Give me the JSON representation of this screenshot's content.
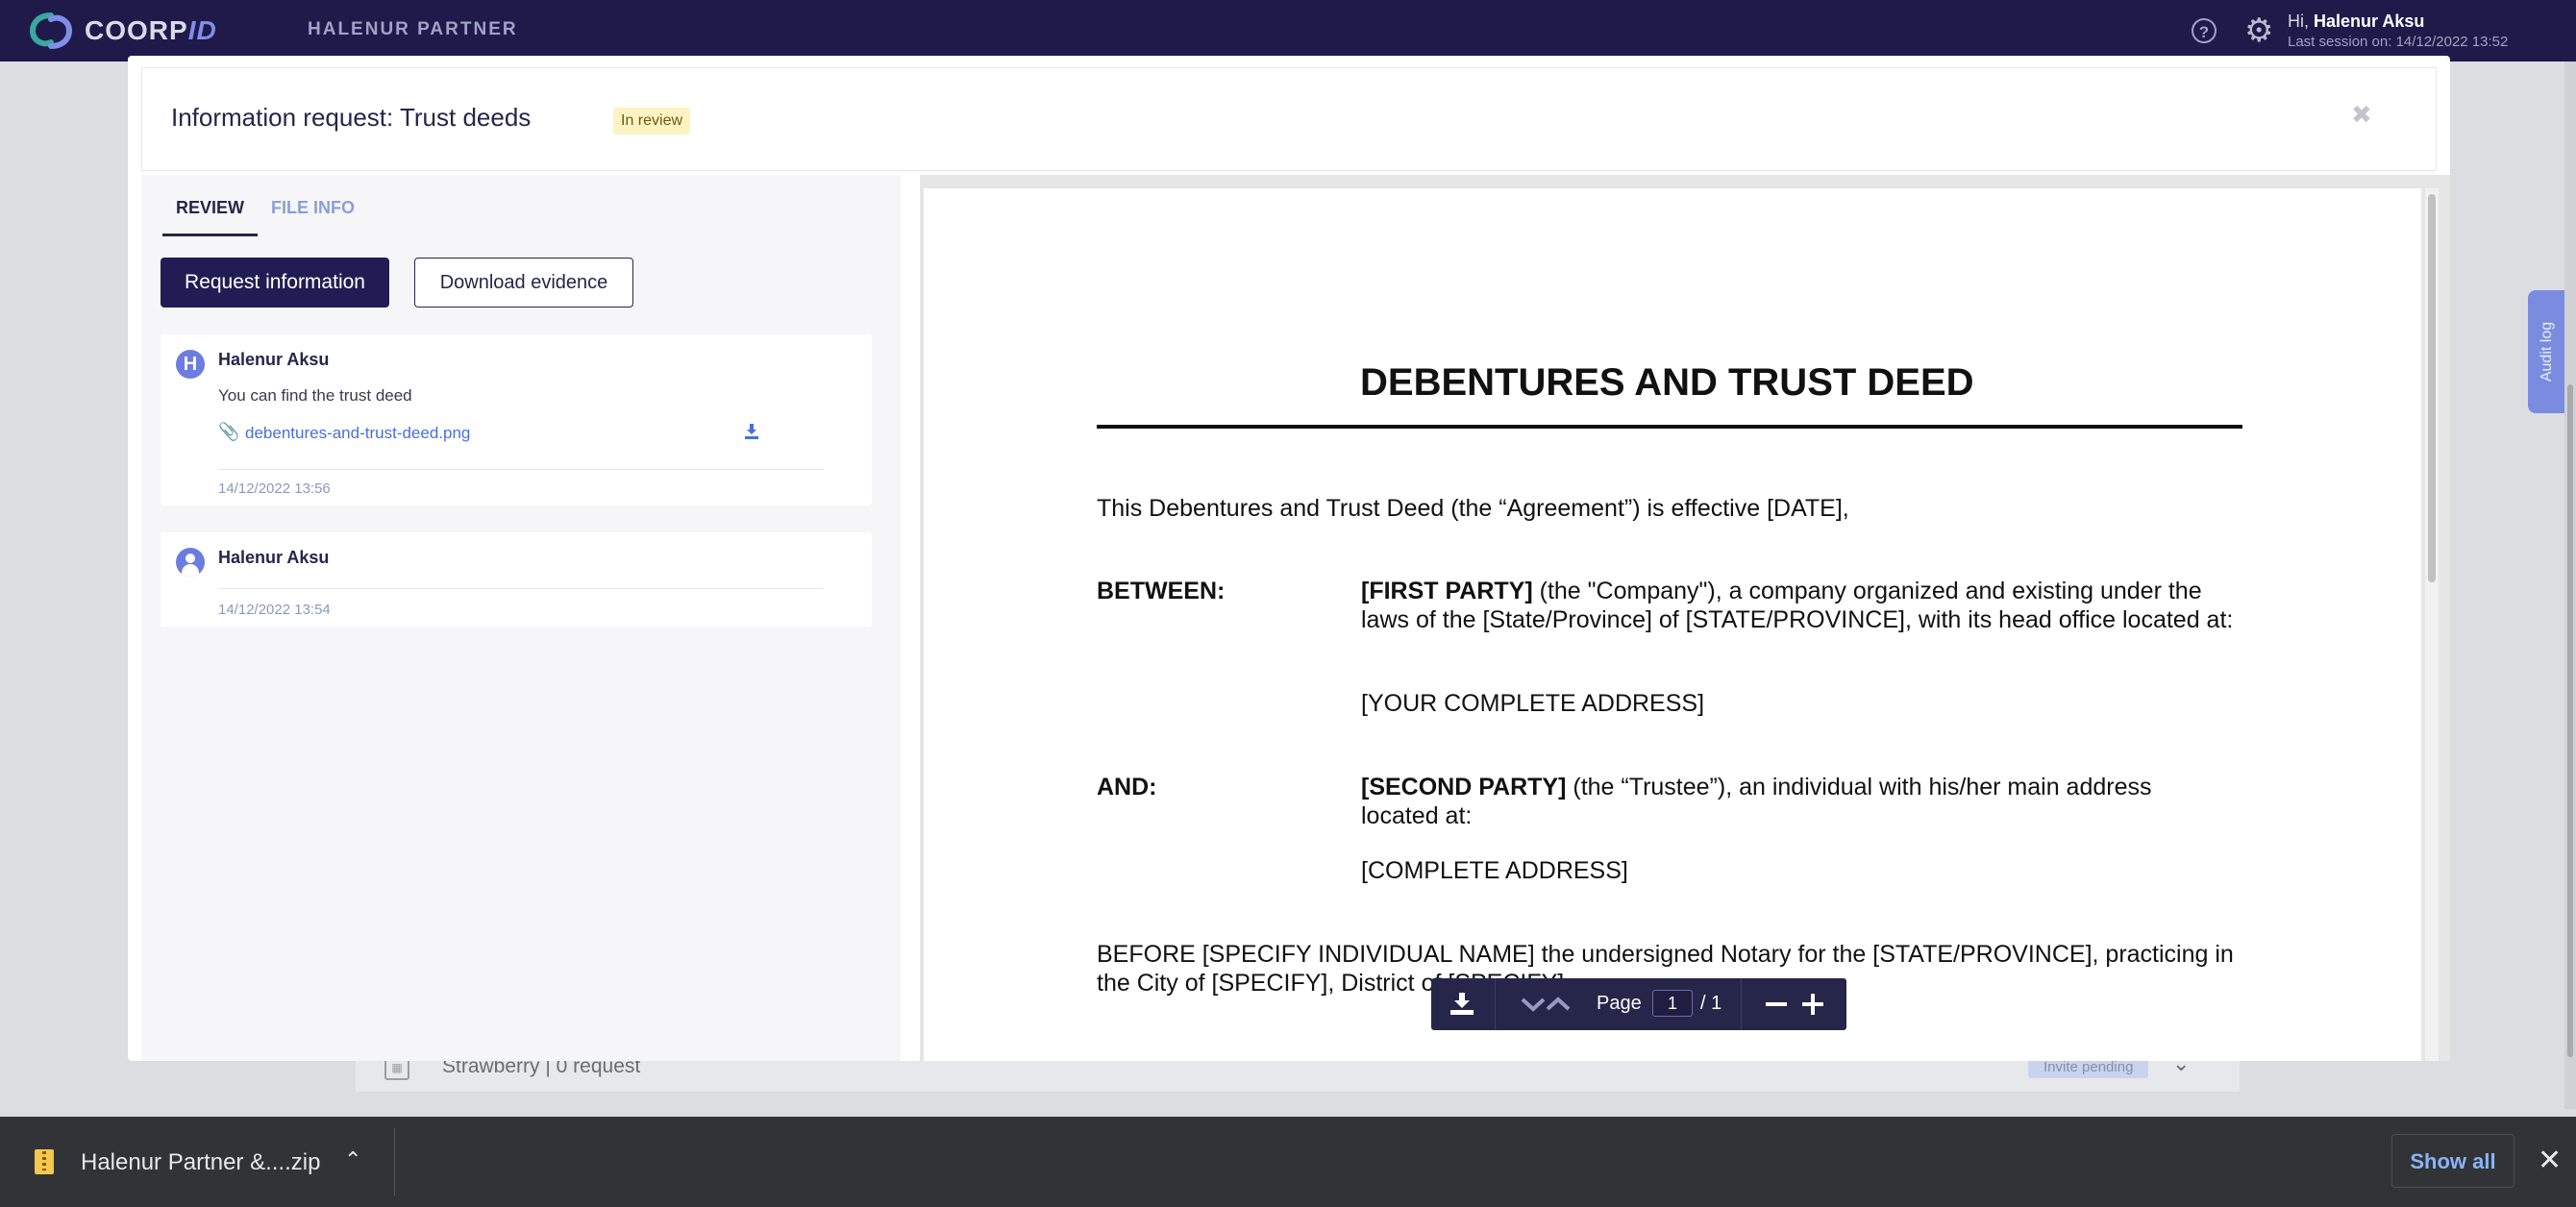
{
  "topbar": {
    "brand_main": "COORP",
    "brand_accent": "ID",
    "company": "HALENUR PARTNER",
    "user_greeting": "Hi, ",
    "user_name": "Halenur Aksu",
    "last_session": "Last session on: 14/12/2022 13:52",
    "colors": {
      "bar": "#1f1a4a",
      "accent": "#7f8fe8"
    }
  },
  "background_list": {
    "row_label": "Strawberry | 0 request",
    "row_badge": "Invite pending"
  },
  "audit_tab": {
    "label": "Audit log"
  },
  "modal": {
    "title": "Information request: Trust deeds",
    "status": "In review",
    "tabs": [
      {
        "label": "REVIEW",
        "active": true
      },
      {
        "label": "FILE INFO",
        "active": false
      }
    ],
    "request_button": "Request information",
    "download_button": "Download evidence",
    "messages": [
      {
        "avatar_letter": "H",
        "author": "Halenur Aksu",
        "text": "You can find the trust deed",
        "attachment": "debentures-and-trust-deed.png",
        "timestamp": "14/12/2022 13:56"
      },
      {
        "author": "Halenur Aksu",
        "timestamp": "14/12/2022 13:54"
      }
    ]
  },
  "document": {
    "title": "DEBENTURES AND TRUST DEED",
    "intro": "This Debentures and Trust Deed (the “Agreement”) is effective [DATE],",
    "between_label": "BETWEEN:",
    "first_party_bold": "[FIRST PARTY]",
    "first_party_text": " (the \"Company\"), a company organized and existing under the laws of the [State/Province] of [STATE/PROVINCE], with its head office located at:",
    "first_party_address": "[YOUR COMPLETE ADDRESS]",
    "and_label": "AND:",
    "second_party_bold": "[SECOND PARTY]",
    "second_party_text": " (the “Trustee”), an individual with his/her main address located at:",
    "second_party_address": "[COMPLETE ADDRESS]",
    "before_text": "BEFORE [SPECIFY INDIVIDUAL NAME] the undersigned Notary for the [STATE/PROVINCE], practicing in the City of [SPECIFY], District of [SPECIFY]"
  },
  "pdf_toolbar": {
    "page_label": "Page",
    "current_page": "1",
    "total_pages": "/ 1"
  },
  "download_shelf": {
    "file_name": "Halenur Partner &....zip",
    "show_all": "Show all"
  }
}
